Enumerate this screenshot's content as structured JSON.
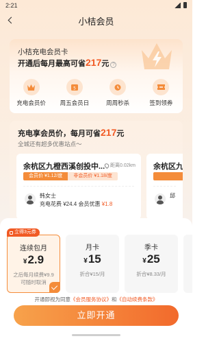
{
  "status_bar": {
    "time": "2:21"
  },
  "nav": {
    "title": "小桔会员"
  },
  "membership_card": {
    "title": "小桔充电会员卡",
    "subtitle_prefix": "开通后每月最高可省",
    "amount": "217",
    "unit": "元",
    "help": "?",
    "benefits": [
      {
        "label": "充电会员价",
        "icon": "crown-icon"
      },
      {
        "label": "周五会员日",
        "icon": "calendar-five-icon"
      },
      {
        "label": "周周秒杀",
        "icon": "alarm-clock-icon"
      },
      {
        "label": "签到领券",
        "icon": "coupon-icon"
      }
    ]
  },
  "stations_card": {
    "title_prefix": "充电享会员价，每月可省",
    "amount": "217",
    "unit": "元",
    "subtitle": "全城还有超多优惠站点～",
    "stations": [
      {
        "name": "余杭区九橙西溪创投中...",
        "distance": "距离0.02km",
        "member_price": "会员价 ¥1.12/度",
        "nonmember_price": "非会员价 ¥1.18/度",
        "user": "韩女士",
        "detail_prefix": "充电花费 ¥24.4  会员优惠",
        "saving": "¥1.8"
      },
      {
        "name": "余杭区九",
        "user": "邱"
      }
    ]
  },
  "plans": {
    "discount_tag": "立得3元券",
    "items": [
      {
        "name": "连续包月",
        "yen": "¥",
        "price": "2.9",
        "note": "之后每月续费¥9.9\n可随时取消",
        "selected": true
      },
      {
        "name": "月卡",
        "yen": "¥",
        "price": "15",
        "note": "折合¥15/月",
        "selected": false
      },
      {
        "name": "季卡",
        "yen": "¥",
        "price": "25",
        "note": "折合¥8.33/月",
        "selected": false
      }
    ],
    "agreement_prefix": "开通即视为同意",
    "agreement_link1": "《会员服务协议》",
    "agreement_and": "和",
    "agreement_link2": "《自动续费条款》",
    "cta": "立即开通"
  },
  "colors": {
    "accent": "#f15a24",
    "accent_light": "#f48c3a",
    "background": "#fde9d6"
  }
}
